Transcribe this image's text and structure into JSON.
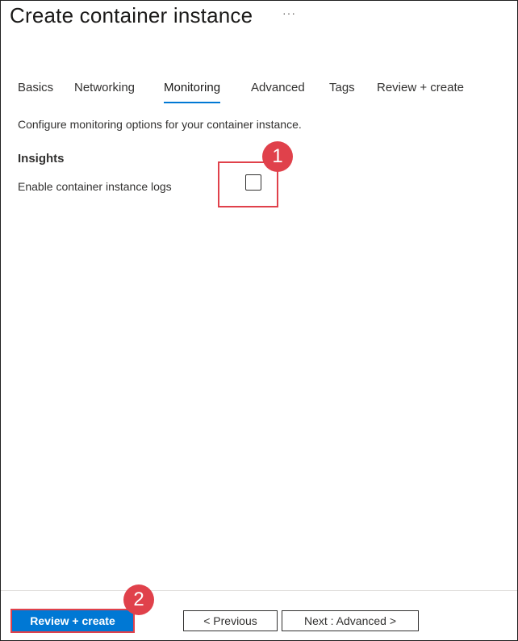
{
  "header": {
    "title": "Create container instance",
    "more_label": "···"
  },
  "tabs": [
    {
      "label": "Basics",
      "active": false
    },
    {
      "label": "Networking",
      "active": false
    },
    {
      "label": "Monitoring",
      "active": true
    },
    {
      "label": "Advanced",
      "active": false
    },
    {
      "label": "Tags",
      "active": false
    },
    {
      "label": "Review + create",
      "active": false
    }
  ],
  "main": {
    "description": "Configure monitoring options for your container instance.",
    "section_title": "Insights",
    "field_label": "Enable container instance logs",
    "checkbox_checked": false
  },
  "annotations": {
    "step1": "1",
    "step2": "2",
    "highlight_color": "#e0414b"
  },
  "footer": {
    "review_create_label": "Review + create",
    "previous_label": "< Previous",
    "next_label": "Next : Advanced >"
  },
  "colors": {
    "accent": "#0078d4",
    "text": "#323130"
  }
}
